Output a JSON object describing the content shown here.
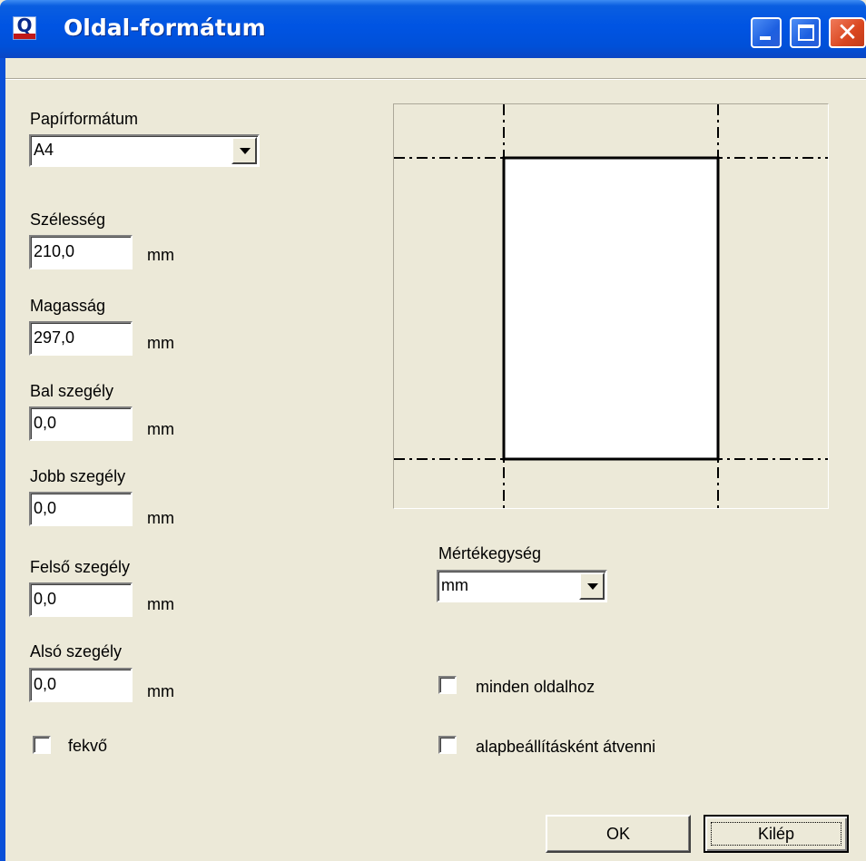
{
  "window": {
    "title": "Oldal-formátum",
    "icon": "qi-stat-app-icon"
  },
  "paper_format": {
    "label": "Papírformátum",
    "value": "A4"
  },
  "fields": {
    "width": {
      "label": "Szélesség",
      "value": "210,0",
      "unit": "mm"
    },
    "height": {
      "label": "Magasság",
      "value": "297,0",
      "unit": "mm"
    },
    "left_margin": {
      "label": "Bal szegély",
      "value": "0,0",
      "unit": "mm"
    },
    "right_margin": {
      "label": "Jobb szegély",
      "value": "0,0",
      "unit": "mm"
    },
    "top_margin": {
      "label": "Felső szegély",
      "value": "0,0",
      "unit": "mm"
    },
    "bottom_margin": {
      "label": "Alsó szegély",
      "value": "0,0",
      "unit": "mm"
    }
  },
  "landscape": {
    "label": "fekvő",
    "checked": false
  },
  "unit_select": {
    "label": "Mértékegység",
    "value": "mm"
  },
  "all_pages": {
    "label": "minden oldalhoz",
    "checked": false
  },
  "as_default": {
    "label": "alapbeállításként átvenni",
    "checked": false
  },
  "buttons": {
    "ok": "OK",
    "exit": "Kilép"
  }
}
